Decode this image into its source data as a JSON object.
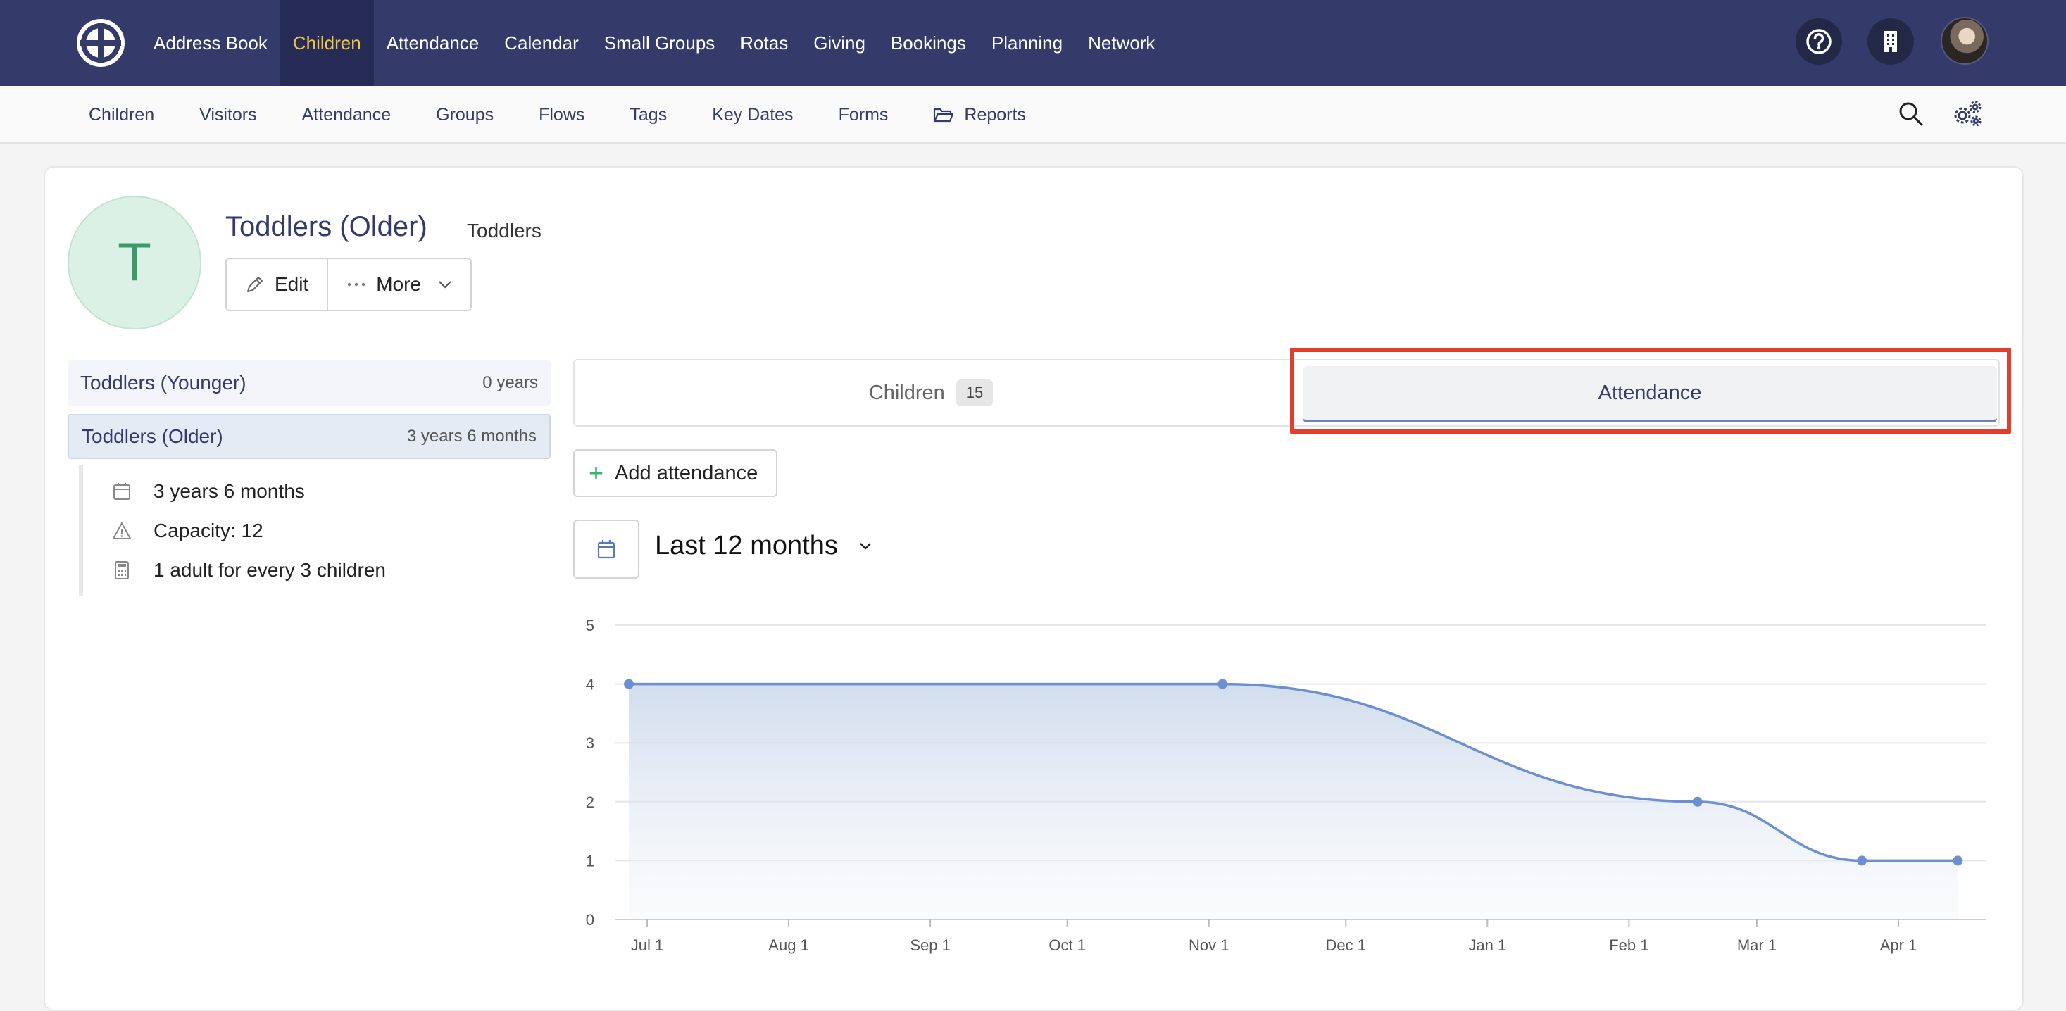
{
  "topnav": {
    "items": [
      {
        "label": "Address Book",
        "active": false
      },
      {
        "label": "Children",
        "active": true
      },
      {
        "label": "Attendance",
        "active": false
      },
      {
        "label": "Calendar",
        "active": false
      },
      {
        "label": "Small Groups",
        "active": false
      },
      {
        "label": "Rotas",
        "active": false
      },
      {
        "label": "Giving",
        "active": false
      },
      {
        "label": "Bookings",
        "active": false
      },
      {
        "label": "Planning",
        "active": false
      },
      {
        "label": "Network",
        "active": false
      }
    ],
    "icons": [
      "help-icon",
      "building-icon",
      "user-avatar"
    ]
  },
  "subnav": {
    "items": [
      "Children",
      "Visitors",
      "Attendance",
      "Groups",
      "Flows",
      "Tags",
      "Key Dates",
      "Forms",
      "Reports"
    ],
    "icons": [
      "search-icon",
      "settings-icon"
    ]
  },
  "group": {
    "initial": "T",
    "title": "Toddlers (Older)",
    "category": "Toddlers",
    "edit_label": "Edit",
    "more_label": "More"
  },
  "sidebar": {
    "groups": [
      {
        "name": "Toddlers (Younger)",
        "age": "0 years"
      },
      {
        "name": "Toddlers (Older)",
        "age": "3 years 6 months"
      }
    ],
    "details": [
      {
        "icon": "calendar-icon",
        "text": "3 years 6 months"
      },
      {
        "icon": "warning-icon",
        "text": "Capacity: 12"
      },
      {
        "icon": "calculator-icon",
        "text": "1 adult for every 3 children"
      }
    ]
  },
  "tabs": {
    "children_label": "Children",
    "children_count": "15",
    "attendance_label": "Attendance"
  },
  "actions": {
    "add_attendance": "Add attendance",
    "date_range": "Last 12 months"
  },
  "colors": {
    "nav_bg": "#343b6b",
    "nav_active": "#f5c542",
    "accent_line": "#6b8fd0",
    "highlight": "#e43d2c"
  },
  "chart_data": {
    "type": "area",
    "x_ticks": [
      "Jul 1",
      "Aug 1",
      "Sep 1",
      "Oct 1",
      "Nov 1",
      "Dec 1",
      "Jan 1",
      "Feb 1",
      "Mar 1",
      "Apr 1"
    ],
    "y_ticks": [
      0,
      1,
      2,
      3,
      4,
      5
    ],
    "ylim": [
      0,
      5
    ],
    "grid": true,
    "points": [
      {
        "x": "Jun 27",
        "y": 4
      },
      {
        "x": "Nov 4",
        "y": 4
      },
      {
        "x": "Feb 16",
        "y": 2
      },
      {
        "x": "Mar 24",
        "y": 1
      },
      {
        "x": "Apr 14",
        "y": 1
      }
    ]
  }
}
